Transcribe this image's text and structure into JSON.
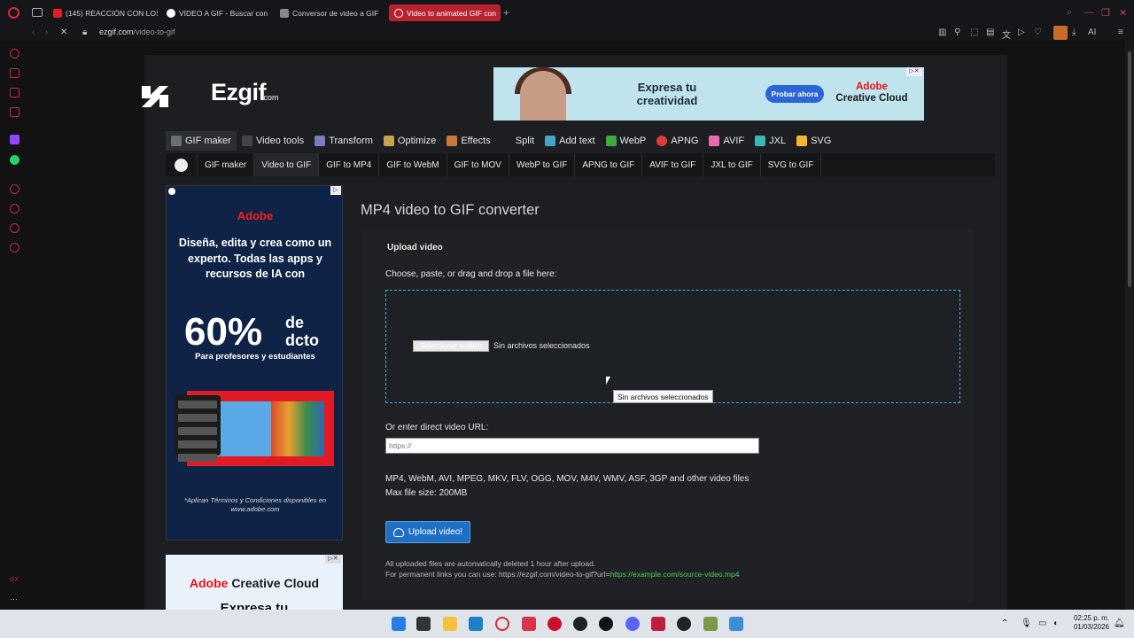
{
  "browser": {
    "tabs": [
      {
        "label": "(145) REACCIÓN CON LOS",
        "color": "#e02020"
      },
      {
        "label": "VIDEO A GIF - Buscar con",
        "color": "#ffffff"
      },
      {
        "label": "Conversor de video a GIF",
        "color": "#cccccc"
      },
      {
        "label": "Video to animated GIF con",
        "color": "#e02020"
      }
    ],
    "new_tab": "+",
    "address": {
      "domain": "ezgif.com",
      "path": "/video-to-gif"
    },
    "ai_label": "AI"
  },
  "site": {
    "logo_text": "Ezgif",
    "logo_suffix": ".com",
    "main_nav": [
      {
        "label": "GIF maker",
        "icon": "gif-maker-icon",
        "color": "#6a6e75"
      },
      {
        "label": "Video tools",
        "icon": "film-icon",
        "color": "#444"
      },
      {
        "label": "Transform",
        "icon": "crop-icon",
        "color": "#7a7dbb"
      },
      {
        "label": "Optimize",
        "icon": "broom-icon",
        "color": "#c9a24a"
      },
      {
        "label": "Effects",
        "icon": "wand-icon",
        "color": "#c9783a"
      },
      {
        "label": "Split",
        "icon": "scissors-icon",
        "color": "#999"
      },
      {
        "label": "Add text",
        "icon": "text-icon",
        "color": "#4aa3c9"
      },
      {
        "label": "WebP",
        "icon": "webp-icon",
        "color": "#3caa3c"
      },
      {
        "label": "APNG",
        "icon": "apng-icon",
        "color": "#e03b3b"
      },
      {
        "label": "AVIF",
        "icon": "avif-icon",
        "color": "#e86bb0"
      },
      {
        "label": "JXL",
        "icon": "jxl-icon",
        "color": "#35b8b0"
      },
      {
        "label": "SVG",
        "icon": "svg-icon",
        "color": "#f2b632"
      }
    ],
    "sub_nav": [
      "GIF maker",
      "Video to GIF",
      "GIF to MP4",
      "GIF to WebM",
      "GIF to MOV",
      "WebP to GIF",
      "APNG to GIF",
      "AVIF to GIF",
      "JXL to GIF",
      "SVG to GIF"
    ]
  },
  "ads": {
    "top": {
      "headline": "Expresa tu creatividad",
      "button": "Probar ahora",
      "brand_line1": "Adobe",
      "brand_line2": "Creative Cloud"
    },
    "side": {
      "brand": "Adobe",
      "copy": "Diseña, edita y crea como un experto. Todas las apps y recursos de IA con",
      "discount": "60%",
      "discount_suffix": "de dcto",
      "audience": "Para profesores y estudiantes",
      "terms": "*Aplican Términos y Condiciones disponibles en www.adobe.com"
    },
    "side2": {
      "line1a": "Adobe",
      "line1b": "Creative Cloud",
      "line2": "Expresa tu"
    }
  },
  "main": {
    "title": "MP4 video to GIF converter",
    "upload_heading": "Upload video",
    "choose_label": "Choose, paste, or drag and drop a file here:",
    "file_button": "Seleccionar archivo",
    "file_status": "Sin archivos seleccionados",
    "tooltip": "Sin archivos seleccionados",
    "url_label": "Or enter direct video URL:",
    "url_placeholder": "https://",
    "formats": "MP4, WebM, AVI, MPEG, MKV, FLV, OGG, MOV, M4V, WMV, ASF, 3GP and other video files",
    "max_size": "Max file size: 200MB",
    "upload_button": "Upload video!",
    "note1": "All uploaded files are automatically deleted 1 hour after upload.",
    "note2_prefix": "For permanent links you can use: https://ezgif.com/video-to-gif?url=",
    "note2_link": "https://example.com/source-video.mp4"
  },
  "taskbar": {
    "time": "02:25 p. m.",
    "date": "01/03/2026"
  },
  "colors": {
    "accent": "#1f6fc5",
    "opera_red": "#e0243a",
    "dropzone_border": "#4fa3e0"
  }
}
